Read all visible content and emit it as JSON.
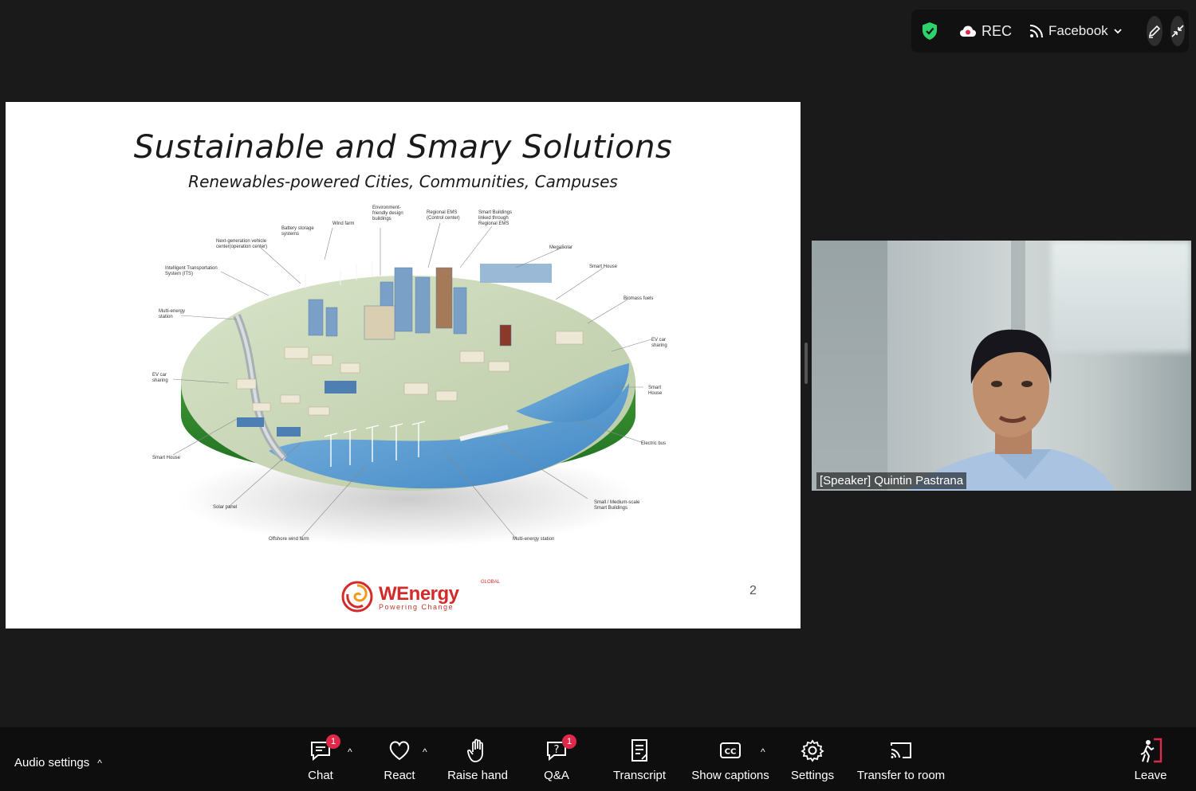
{
  "status_bar": {
    "rec_label": "REC",
    "stream_label": "Facebook"
  },
  "slide": {
    "title": "Sustainable and Smary Solutions",
    "subtitle": "Renewables-powered Cities, Communities, Campuses",
    "page_number": "2",
    "logo": {
      "name": "WEnergy",
      "global": "GLOBAL",
      "tagline": "Powering Change"
    },
    "labels": {
      "wind_farm": "Wind farm",
      "env_buildings": "Environment-friendly design buildings",
      "regional_ems": "Regional EMS (Control center)",
      "smart_buildings": "Smart Buildings linked through Regional EMS",
      "battery": "Battery storage systems",
      "next_gen": "Next-generation vehicle center(operation center)",
      "its": "Intelligent Transportation System (ITS)",
      "mega_solar": "MegaSolar",
      "smart_house_top": "Smart House",
      "biomass": "Biomass fuels",
      "multi_energy_left": "Multi-energy station",
      "ev_right": "EV car sharing",
      "ev_left": "EV car sharing",
      "smart_house_right": "Smart House",
      "electric_bus": "Electric bus",
      "smart_house_left": "Smart House",
      "solar_panel": "Solar panel",
      "small_medium": "Small / Medium-scale Smart Buildings",
      "offshore_wind": "Offshore wind farm",
      "multi_energy_bottom": "Multi-energy station"
    }
  },
  "video": {
    "speaker_name": "[Speaker] Quintin Pastrana"
  },
  "toolbar": {
    "audio_settings": "Audio settings",
    "chat": "Chat",
    "chat_badge": "1",
    "react": "React",
    "raise_hand": "Raise hand",
    "qa": "Q&A",
    "qa_badge": "1",
    "transcript": "Transcript",
    "show_captions": "Show captions",
    "settings": "Settings",
    "transfer": "Transfer to room",
    "leave": "Leave"
  },
  "colors": {
    "toolbar_bg": "#0e0e0e",
    "badge": "#e0294a",
    "shield": "#2bd36a",
    "leave": "#e0294a"
  }
}
